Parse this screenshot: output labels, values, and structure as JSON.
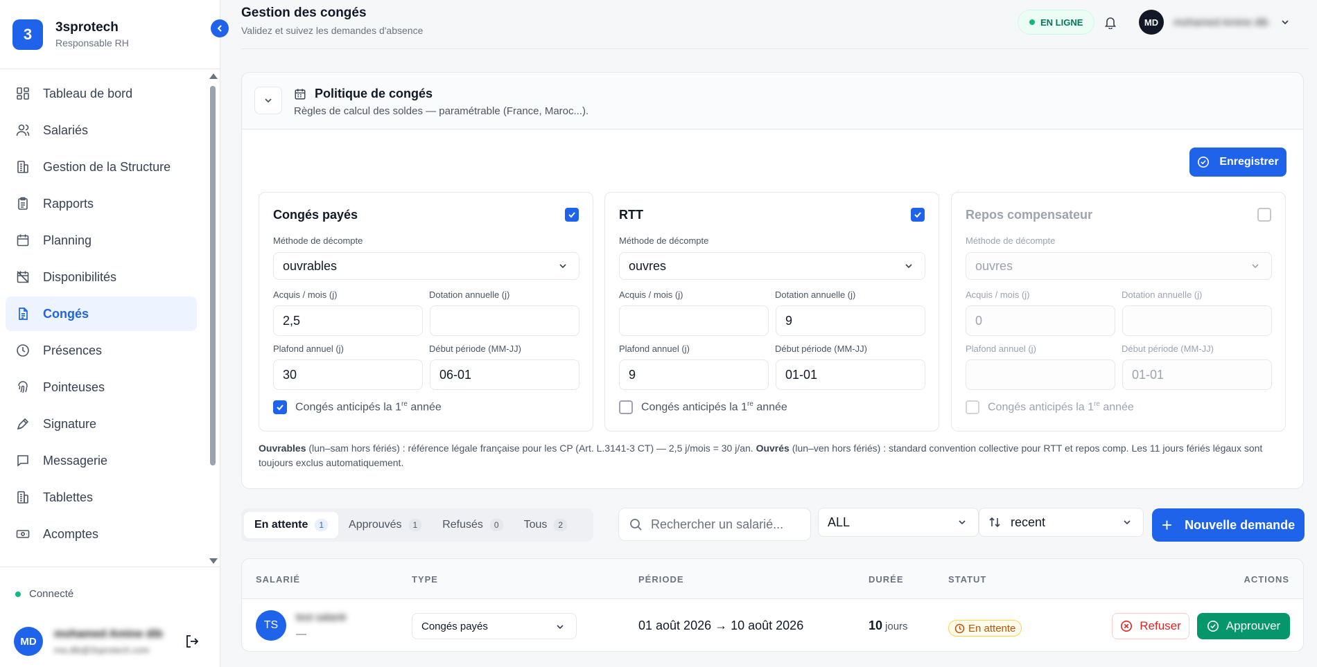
{
  "brand": {
    "logo_letter": "3",
    "name": "3sprotech",
    "role": "Responsable RH"
  },
  "sidebar": {
    "items": [
      {
        "label": "Tableau de bord",
        "icon": "dashboard-icon"
      },
      {
        "label": "Salariés",
        "icon": "users-icon"
      },
      {
        "label": "Gestion de la Structure",
        "icon": "building-icon"
      },
      {
        "label": "Rapports",
        "icon": "clipboard-icon"
      },
      {
        "label": "Planning",
        "icon": "calendar-icon"
      },
      {
        "label": "Disponibilités",
        "icon": "calendar-off-icon"
      },
      {
        "label": "Congés",
        "icon": "file-text-icon",
        "active": true
      },
      {
        "label": "Présences",
        "icon": "clock-icon"
      },
      {
        "label": "Pointeuses",
        "icon": "fingerprint-icon"
      },
      {
        "label": "Signature",
        "icon": "pen-icon"
      },
      {
        "label": "Messagerie",
        "icon": "message-icon"
      },
      {
        "label": "Tablettes",
        "icon": "building-icon"
      },
      {
        "label": "Acomptes",
        "icon": "banknote-icon"
      }
    ],
    "status": "Connecté",
    "user": {
      "initials": "MD",
      "name": "mohamed Amine dib",
      "email": "ma.dib@3sprotech.com"
    }
  },
  "header": {
    "title": "Gestion des congés",
    "subtitle": "Validez et suivez les demandes d'absence",
    "online_label": "EN LIGNE",
    "user_initials": "MD",
    "user_name": "mohamed Amine dib"
  },
  "policy": {
    "title": "Politique de congés",
    "subtitle": "Règles de calcul des soldes — paramétrable (France, Maroc...).",
    "save_label": "Enregistrer",
    "labels": {
      "method": "Méthode de décompte",
      "acquis": "Acquis / mois (j)",
      "dotation": "Dotation annuelle (j)",
      "plafond": "Plafond annuel (j)",
      "debut": "Début période (MM-JJ)",
      "anticipes_prefix": "Congés anticipés la 1",
      "anticipes_sup": "re",
      "anticipes_suffix": " année"
    },
    "cards": [
      {
        "title": "Congés payés",
        "enabled": true,
        "method": "ouvrables",
        "acquis": "2,5",
        "dotation": "",
        "plafond": "30",
        "debut": "06-01",
        "anticipes": true
      },
      {
        "title": "RTT",
        "enabled": true,
        "method": "ouvres",
        "acquis": "",
        "dotation": "9",
        "plafond": "9",
        "debut": "01-01",
        "anticipes": false
      },
      {
        "title": "Repos compensateur",
        "enabled": false,
        "method": "ouvres",
        "acquis": "0",
        "dotation": "",
        "plafond": "",
        "debut": "01-01",
        "anticipes": false
      }
    ],
    "note": {
      "ouvrables_bold": "Ouvrables",
      "ouvrables_text": " (lun–sam hors fériés) : référence légale française pour les CP (Art. L.3141-3 CT) — 2,5 j/mois = 30 j/an. ",
      "ouvres_bold": "Ouvrés",
      "ouvres_text": " (lun–ven hors fériés) : standard convention collective pour RTT et repos comp.  Les 11 jours fériés légaux sont toujours exclus automatiquement."
    }
  },
  "toolbar": {
    "tabs": [
      {
        "label": "En attente",
        "count": "1",
        "active": true
      },
      {
        "label": "Approuvés",
        "count": "1"
      },
      {
        "label": "Refusés",
        "count": "0"
      },
      {
        "label": "Tous",
        "count": "2"
      }
    ],
    "search_placeholder": "Rechercher un salarié...",
    "type_filter": "ALL",
    "sort": "recent",
    "new_label": "Nouvelle demande"
  },
  "table": {
    "headers": {
      "employee": "SALARIÉ",
      "type": "TYPE",
      "period": "PÉRIODE",
      "duration": "DURÉE",
      "status": "STATUT",
      "actions": "ACTIONS"
    },
    "rows": [
      {
        "initials": "TS",
        "name": "test salarié",
        "sub": "—",
        "type": "Congés payés",
        "period": "01 août 2026 → 10 août 2026",
        "duration": "10",
        "duration_unit": "jours",
        "status": "En attente",
        "refuse_label": "Refuser",
        "approve_label": "Approuver"
      }
    ]
  },
  "colors": {
    "primary": "#1e63e9",
    "success": "#059669",
    "danger": "#dc2626",
    "warning": "#b45309"
  }
}
